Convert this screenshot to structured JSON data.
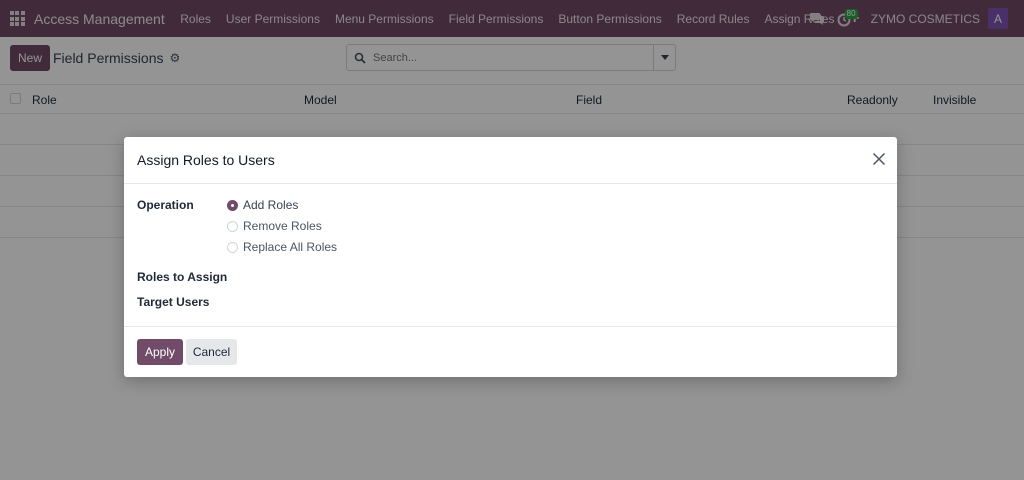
{
  "navbar": {
    "app_name": "Access Management",
    "items": [
      "Roles",
      "User Permissions",
      "Menu Permissions",
      "Field Permissions",
      "Button Permissions",
      "Record Rules",
      "Assign Roles"
    ],
    "plus_label": "+",
    "activity_count": "80",
    "company": "ZYMO COSMETICS",
    "avatar_letter": "A"
  },
  "control": {
    "new_label": "New",
    "breadcrumb": "Field Permissions",
    "search_placeholder": "Search..."
  },
  "list": {
    "columns": [
      "Role",
      "Model",
      "Field",
      "Readonly",
      "Invisible"
    ]
  },
  "modal": {
    "title": "Assign Roles to Users",
    "operation_label": "Operation",
    "options": [
      "Add Roles",
      "Remove Roles",
      "Replace All Roles"
    ],
    "selected_option": "Add Roles",
    "roles_label": "Roles to Assign",
    "users_label": "Target Users",
    "apply_label": "Apply",
    "cancel_label": "Cancel"
  },
  "colors": {
    "brand": "#714b67",
    "avatar": "#7e54b6",
    "badge": "#28a745"
  }
}
